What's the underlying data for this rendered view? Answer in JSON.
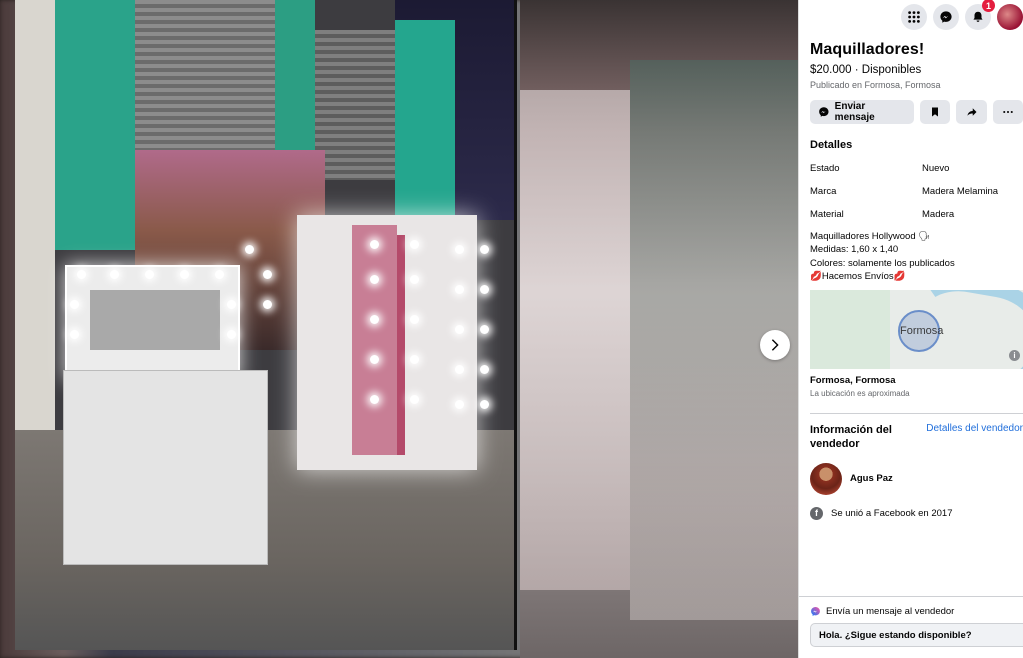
{
  "listing": {
    "title": "Maquilladores!",
    "price_line": "$20.000 · Disponibles",
    "published": "Publicado en Formosa, Formosa"
  },
  "actions": {
    "send_message_label": "Enviar mensaje",
    "save_icon": "bookmark-icon",
    "share_icon": "share-icon",
    "more_icon": "more-icon"
  },
  "details": {
    "section_title": "Detalles",
    "rows": [
      {
        "key": "Estado",
        "value": "Nuevo"
      },
      {
        "key": "Marca",
        "value": "Madera Melamina"
      },
      {
        "key": "Material",
        "value": "Madera"
      }
    ],
    "description": [
      "Maquilladores Hollywood 🗣",
      "Medidas: 1,60 x 1,40",
      "Colores: solamente los publicados",
      "💋Hacemos Envíos💋"
    ]
  },
  "map": {
    "label": "Formosa",
    "place": "Formosa, Formosa",
    "approx": "La ubicación es aproximada"
  },
  "seller": {
    "section_title": "Información del vendedor",
    "details_link": "Detalles del vendedor",
    "name": "Agus Paz",
    "joined": "Se unió a Facebook en 2017"
  },
  "message_box": {
    "label": "Envía un mensaje al vendedor",
    "value": "Hola. ¿Sigue estando disponible?"
  },
  "topbar": {
    "notification_count": "1"
  },
  "colors": {
    "accent_link": "#216fdb",
    "badge": "#e41e3f",
    "button_bg": "#e4e6eb"
  }
}
